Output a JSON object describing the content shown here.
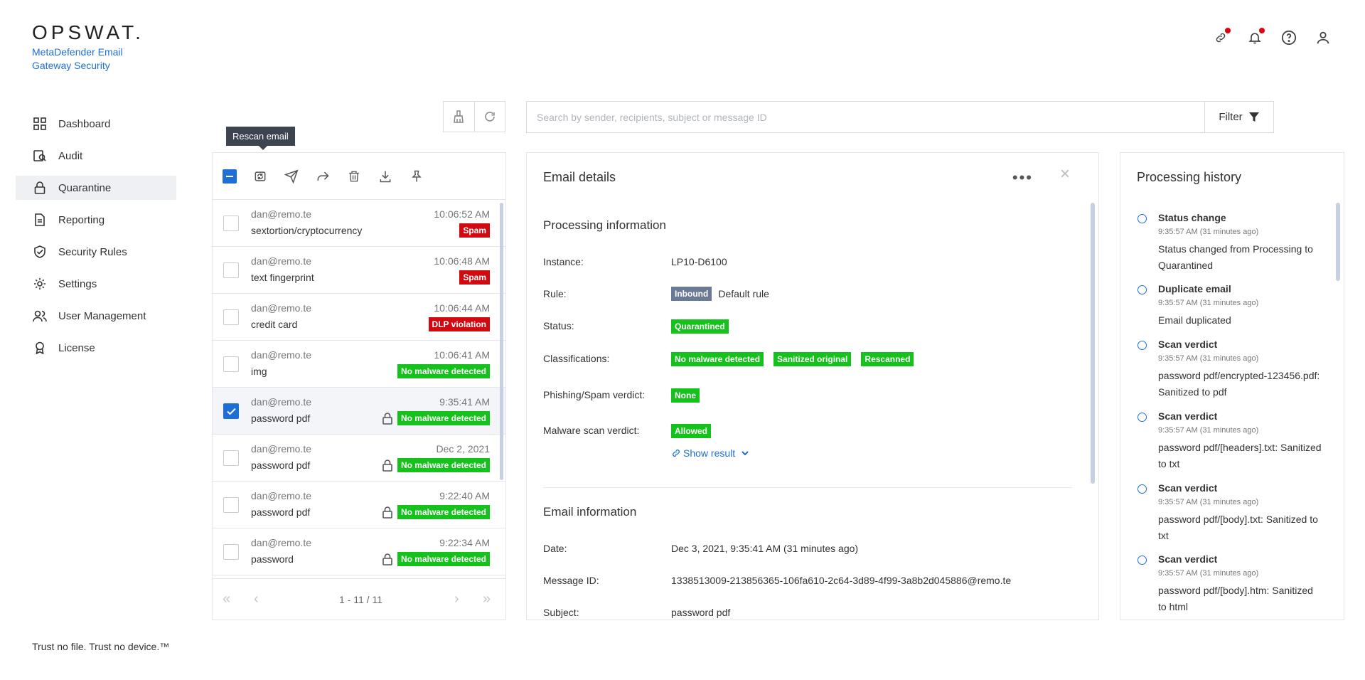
{
  "brand": {
    "logo": "OPSWAT.",
    "product": "MetaDefender Email Gateway Security",
    "footer": "Trust no file. Trust no device.™"
  },
  "top_icons": [
    "link-icon",
    "bell-icon",
    "help-icon",
    "user-icon"
  ],
  "nav": [
    {
      "label": "Dashboard",
      "icon": "grid-icon"
    },
    {
      "label": "Audit",
      "icon": "audit-icon"
    },
    {
      "label": "Quarantine",
      "icon": "lock-icon",
      "active": true
    },
    {
      "label": "Reporting",
      "icon": "report-icon"
    },
    {
      "label": "Security Rules",
      "icon": "shield-check-icon"
    },
    {
      "label": "Settings",
      "icon": "gear-icon"
    },
    {
      "label": "User Management",
      "icon": "users-icon"
    },
    {
      "label": "License",
      "icon": "award-icon"
    }
  ],
  "search": {
    "placeholder": "Search by sender, recipients, subject or message ID"
  },
  "filter_label": "Filter",
  "tooltip": "Rescan email",
  "emails": [
    {
      "from": "dan@remo.te",
      "subject": "sextortion/cryptocurrency",
      "time": "10:06:52 AM",
      "badge": "Spam",
      "badge_color": "red",
      "locked": false,
      "checked": false
    },
    {
      "from": "dan@remo.te",
      "subject": "text fingerprint",
      "time": "10:06:48 AM",
      "badge": "Spam",
      "badge_color": "red",
      "locked": false,
      "checked": false
    },
    {
      "from": "dan@remo.te",
      "subject": "credit card",
      "time": "10:06:44 AM",
      "badge": "DLP violation",
      "badge_color": "red",
      "locked": false,
      "checked": false
    },
    {
      "from": "dan@remo.te",
      "subject": "img",
      "time": "10:06:41 AM",
      "badge": "No malware detected",
      "badge_color": "green",
      "locked": false,
      "checked": false
    },
    {
      "from": "dan@remo.te",
      "subject": "password pdf",
      "time": "9:35:41 AM",
      "badge": "No malware detected",
      "badge_color": "green",
      "locked": true,
      "checked": true
    },
    {
      "from": "dan@remo.te",
      "subject": "password pdf",
      "time": "Dec 2, 2021",
      "badge": "No malware detected",
      "badge_color": "green",
      "locked": true,
      "checked": false
    },
    {
      "from": "dan@remo.te",
      "subject": "password pdf",
      "time": "9:22:40 AM",
      "badge": "No malware detected",
      "badge_color": "green",
      "locked": true,
      "checked": false
    },
    {
      "from": "dan@remo.te",
      "subject": "password",
      "time": "9:22:34 AM",
      "badge": "No malware detected",
      "badge_color": "green",
      "locked": true,
      "checked": false
    }
  ],
  "pagination": "1 - 11 / 11",
  "details": {
    "title": "Email details",
    "processing_title": "Processing information",
    "instance_label": "Instance:",
    "instance": "LP10-D6100",
    "rule_label": "Rule:",
    "rule_badge": "Inbound",
    "rule": "Default rule",
    "status_label": "Status:",
    "status": "Quarantined",
    "classifications_label": "Classifications:",
    "classifications": [
      "No malware detected",
      "Sanitized original",
      "Rescanned"
    ],
    "phishing_label": "Phishing/Spam verdict:",
    "phishing": "None",
    "malware_label": "Malware scan verdict:",
    "malware": "Allowed",
    "show_result": "Show result",
    "email_info_title": "Email information",
    "date_label": "Date:",
    "date": "Dec 3, 2021, 9:35:41 AM (31 minutes ago)",
    "message_id_label": "Message ID:",
    "message_id": "1338513009-213856365-106fa610-2c64-3d89-4f99-3a8b2d045886@remo.te",
    "subject_label": "Subject:",
    "subject": "password pdf"
  },
  "history": {
    "title": "Processing history",
    "items": [
      {
        "title": "Status change",
        "time": "9:35:57 AM (31 minutes ago)",
        "desc": "Status changed from Processing to Quarantined"
      },
      {
        "title": "Duplicate email",
        "time": "9:35:57 AM (31 minutes ago)",
        "desc": "Email duplicated"
      },
      {
        "title": "Scan verdict",
        "time": "9:35:57 AM (31 minutes ago)",
        "desc": "password pdf/encrypted-123456.pdf: Sanitized to pdf"
      },
      {
        "title": "Scan verdict",
        "time": "9:35:57 AM (31 minutes ago)",
        "desc": "password pdf/[headers].txt: Sanitized to txt"
      },
      {
        "title": "Scan verdict",
        "time": "9:35:57 AM (31 minutes ago)",
        "desc": "password pdf/[body].txt: Sanitized to txt"
      },
      {
        "title": "Scan verdict",
        "time": "9:35:57 AM (31 minutes ago)",
        "desc": "password pdf/[body].htm: Sanitized to html"
      }
    ]
  }
}
